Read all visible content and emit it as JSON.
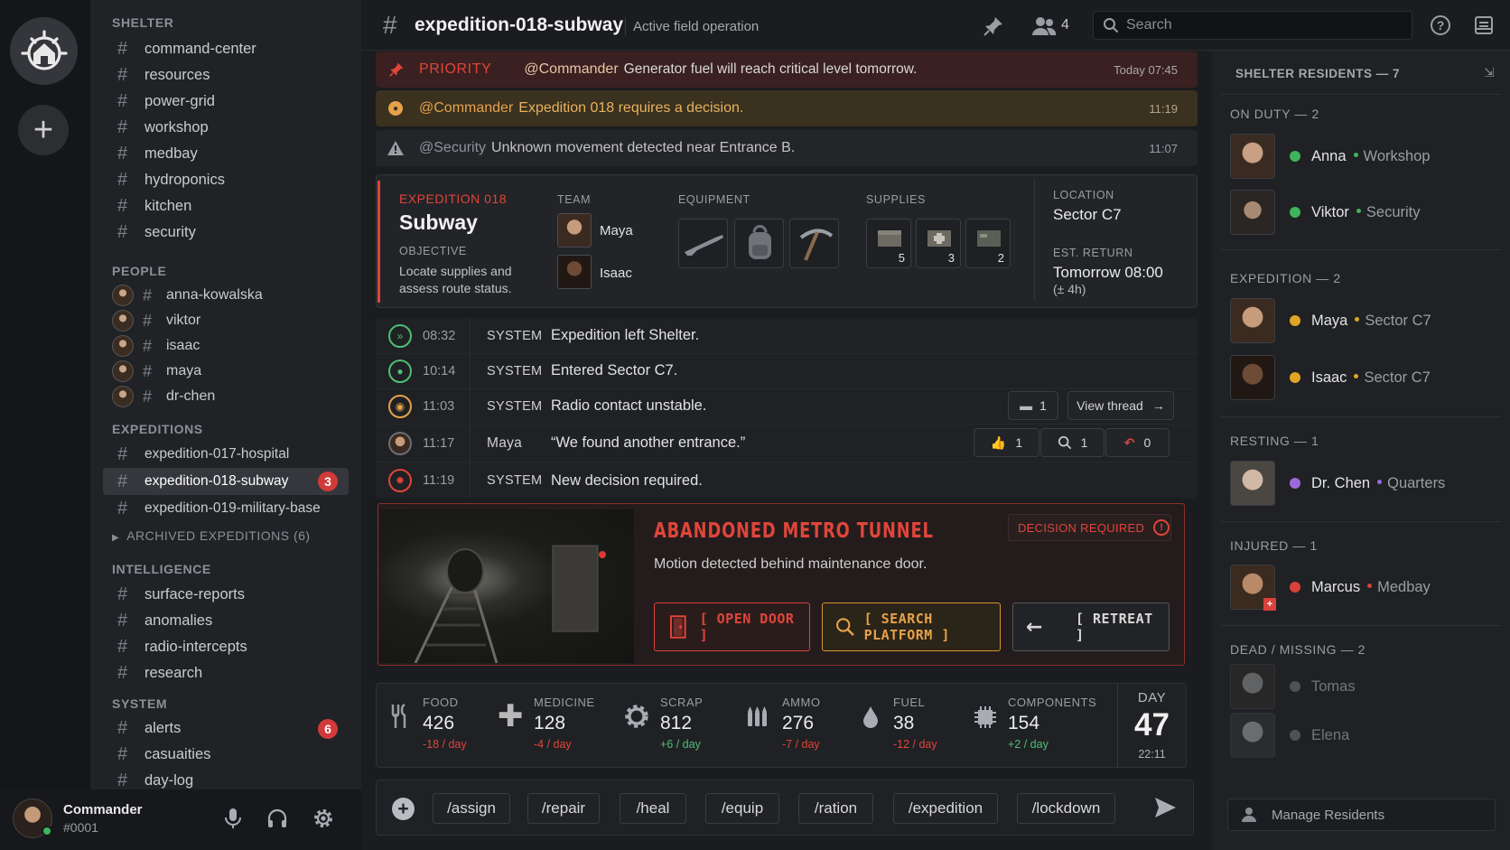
{
  "app": {
    "user_name": "Commander",
    "user_tag": "#0001"
  },
  "header": {
    "channel": "expedition-018-subway",
    "description": "Active field operation",
    "member_count": "4",
    "search_placeholder": "Search"
  },
  "sidebar": {
    "shelter_label": "SHELTER",
    "shelter_channels": [
      "command-center",
      "resources",
      "power-grid",
      "workshop",
      "medbay",
      "hydroponics",
      "kitchen",
      "security"
    ],
    "people_label": "PEOPLE",
    "people_channels": [
      "anna-kowalska",
      "viktor",
      "isaac",
      "maya",
      "dr-chen"
    ],
    "expeditions_label": "EXPEDITIONS",
    "expedition_channels": [
      {
        "name": "expedition-017-hospital",
        "badge": ""
      },
      {
        "name": "expedition-018-subway",
        "badge": "3"
      },
      {
        "name": "expedition-019-military-base",
        "badge": ""
      }
    ],
    "archived": "ARCHIVED EXPEDITIONS (6)",
    "intelligence_label": "INTELLIGENCE",
    "intelligence_channels": [
      "surface-reports",
      "anomalies",
      "radio-intercepts",
      "research"
    ],
    "system_label": "SYSTEM",
    "system_channels": [
      {
        "name": "alerts",
        "badge": "6"
      },
      {
        "name": "casuaities",
        "badge": ""
      },
      {
        "name": "day-log",
        "badge": ""
      }
    ]
  },
  "alerts": [
    {
      "tag": "PRIORITY",
      "mention": "@Commander",
      "text": "Generator fuel will reach critical level tomorrow.",
      "time": "Today 07:45"
    },
    {
      "mention": "@Commander",
      "text": "Expedition 018 requires a decision.",
      "time": "11:19"
    },
    {
      "mention": "@Security",
      "text": "Unknown movement detected near Entrance B.",
      "time": "11:07"
    }
  ],
  "expedition": {
    "code": "EXPEDITION 018",
    "name": "Subway",
    "objective_label": "OBJECTIVE",
    "objective": "Locate supplies and assess route status.",
    "team_label": "TEAM",
    "team": [
      "Maya",
      "Isaac"
    ],
    "equipment_label": "EQUIPMENT",
    "equipment": [
      "rifle-icon",
      "backpack-icon",
      "pickaxe-icon"
    ],
    "supplies_label": "SUPPLIES",
    "supplies": [
      {
        "icon": "crate-icon",
        "count": "5"
      },
      {
        "icon": "medkit-icon",
        "count": "3"
      },
      {
        "icon": "ammo-box-icon",
        "count": "2"
      }
    ],
    "location_label": "LOCATION",
    "location": "Sector C7",
    "return_label": "EST. RETURN",
    "return": "Tomorrow 08:00",
    "return_note": "(± 4h)"
  },
  "timeline": [
    {
      "time": "08:32",
      "author": "SYSTEM",
      "text": "Expedition left Shelter."
    },
    {
      "time": "10:14",
      "author": "SYSTEM",
      "text": "Entered Sector C7."
    },
    {
      "time": "11:03",
      "author": "SYSTEM",
      "text": "Radio contact unstable.",
      "replies": "1",
      "thread": "View thread"
    },
    {
      "time": "11:17",
      "author": "Maya",
      "text": "“We found another entrance.”",
      "likes": "1",
      "searches": "1",
      "returns": "0"
    },
    {
      "time": "11:19",
      "author": "SYSTEM",
      "text": "New decision required."
    }
  ],
  "decision": {
    "title": "ABANDONED METRO TUNNEL",
    "badge": "DECISION REQUIRED",
    "text": "Motion detected behind maintenance door.",
    "options": [
      "[ OPEN DOOR ]",
      "[ SEARCH PLATFORM ]",
      "[ RETREAT ]"
    ]
  },
  "resources": [
    {
      "name": "FOOD",
      "value": "426",
      "rate": "-18 / day"
    },
    {
      "name": "MEDICINE",
      "value": "128",
      "rate": "-4 / day"
    },
    {
      "name": "SCRAP",
      "value": "812",
      "rate": "+6 / day"
    },
    {
      "name": "AMMO",
      "value": "276",
      "rate": "-7 / day"
    },
    {
      "name": "FUEL",
      "value": "38",
      "rate": "-12 / day"
    },
    {
      "name": "COMPONENTS",
      "value": "154",
      "rate": "+2 / day"
    }
  ],
  "day": {
    "label": "DAY",
    "number": "47",
    "time": "22:11"
  },
  "commands": [
    "/assign",
    "/repair",
    "/heal",
    "/equip",
    "/ration",
    "/expedition",
    "/lockdown"
  ],
  "residents": {
    "title": "SHELTER RESIDENTS — 7",
    "groups": [
      {
        "label": "ON DUTY — 2",
        "members": [
          {
            "name": "Anna",
            "loc": "Workshop",
            "status": "#3fb45a"
          },
          {
            "name": "Viktor",
            "loc": "Security",
            "status": "#3fb45a"
          }
        ]
      },
      {
        "label": "EXPEDITION — 2",
        "members": [
          {
            "name": "Maya",
            "loc": "Sector C7",
            "status": "#e0a526"
          },
          {
            "name": "Isaac",
            "loc": "Sector C7",
            "status": "#e0a526"
          }
        ]
      },
      {
        "label": "RESTING — 1",
        "members": [
          {
            "name": "Dr. Chen",
            "loc": "Quarters",
            "status": "#9b6ad8"
          }
        ]
      },
      {
        "label": "INJURED — 1",
        "members": [
          {
            "name": "Marcus",
            "loc": "Medbay",
            "status": "#d9413b"
          }
        ]
      },
      {
        "label": "DEAD / MISSING — 2",
        "members": [
          {
            "name": "Tomas",
            "loc": "",
            "status": "#6d6f74"
          },
          {
            "name": "Elena",
            "loc": "",
            "status": "#6d6f74"
          }
        ]
      }
    ],
    "manage": "Manage Residents"
  },
  "colors": {
    "accent_red": "#e0453a",
    "accent_orange": "#e6a24a",
    "positive": "#4fbf73",
    "negative": "#e0453a"
  }
}
